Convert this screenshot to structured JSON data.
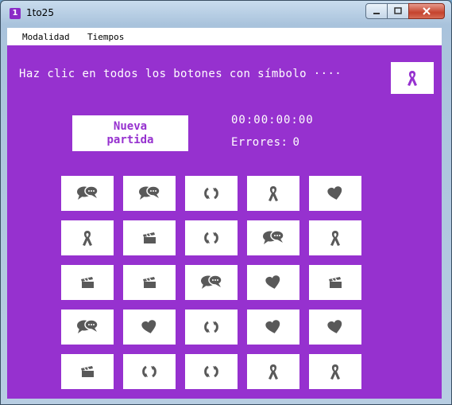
{
  "window": {
    "title": "1to25",
    "app_icon": "1"
  },
  "menu": {
    "items": [
      "Modalidad",
      "Tiempos"
    ]
  },
  "game": {
    "instruction": "Haz clic en todos los botones con símbolo ····",
    "target_icon": "ribbon",
    "new_game_label": "Nueva\npartida",
    "timer": "00:00:00:00",
    "errors_label": "Errores:",
    "errors_value": "0"
  },
  "grid": [
    [
      "chat",
      "chat",
      "recycle",
      "ribbon",
      "heart"
    ],
    [
      "ribbon",
      "clapper",
      "recycle",
      "chat",
      "ribbon"
    ],
    [
      "clapper",
      "clapper",
      "chat",
      "heart",
      "clapper"
    ],
    [
      "chat",
      "heart",
      "recycle",
      "heart",
      "heart"
    ],
    [
      "clapper",
      "recycle",
      "recycle",
      "ribbon",
      "ribbon"
    ]
  ],
  "colors": {
    "background": "#9631cf",
    "icon": "#595959",
    "target_icon": "#9631cf"
  }
}
